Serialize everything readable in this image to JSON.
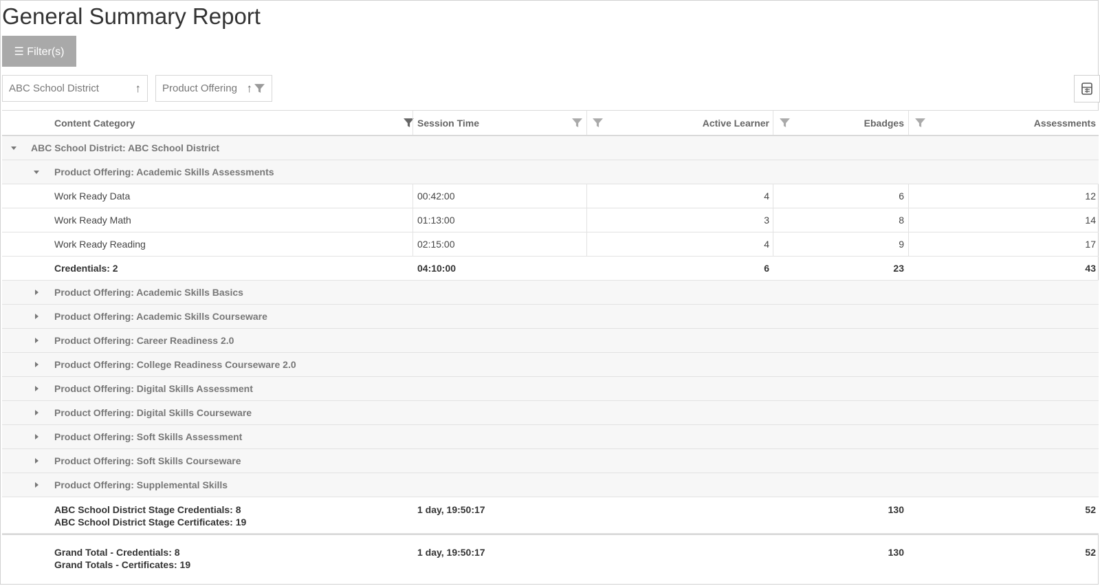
{
  "page": {
    "title": "General Summary Report"
  },
  "toolbar": {
    "filter_label": "☰ Filter(s)"
  },
  "grouping": {
    "chips": [
      {
        "label": "ABC School District"
      },
      {
        "label": "Product Offering"
      }
    ]
  },
  "grid": {
    "columns": {
      "category": "Content Category",
      "session": "Session Time",
      "active": "Active Learner",
      "ebadges": "Ebadges",
      "assessments": "Assessments"
    },
    "district_row": {
      "label": "ABC School District: ABC School District"
    },
    "expanded_offering": {
      "label": "Product Offering: Academic Skills Assessments"
    },
    "data_rows": [
      {
        "category": "Work Ready Data",
        "session": "00:42:00",
        "active": "4",
        "ebadges": "6",
        "assessments": "12"
      },
      {
        "category": "Work Ready Math",
        "session": "01:13:00",
        "active": "3",
        "ebadges": "8",
        "assessments": "14"
      },
      {
        "category": "Work Ready Reading",
        "session": "02:15:00",
        "active": "4",
        "ebadges": "9",
        "assessments": "17"
      }
    ],
    "group_summary": {
      "category": "Credentials: 2",
      "session": "04:10:00",
      "active": "6",
      "ebadges": "23",
      "assessments": "43"
    },
    "collapsed_offerings": [
      {
        "label": "Product Offering: Academic Skills Basics"
      },
      {
        "label": "Product Offering: Academic Skills Courseware"
      },
      {
        "label": "Product Offering: Career Readiness 2.0"
      },
      {
        "label": "Product Offering: College Readiness Courseware 2.0"
      },
      {
        "label": "Product Offering: Digital Skills Assessment"
      },
      {
        "label": "Product Offering: Digital Skills Courseware"
      },
      {
        "label": "Product Offering: Soft Skills Assessment"
      },
      {
        "label": "Product Offering: Soft Skills Courseware"
      },
      {
        "label": "Product Offering: Supplemental Skills"
      }
    ],
    "district_total": {
      "line1": "ABC School District Stage Credentials: 8",
      "line2": "ABC School District Stage Certificates: 19",
      "session": "1 day, 19:50:17",
      "ebadges": "130",
      "assessments": "52"
    },
    "grand_total": {
      "line1": "Grand Total - Credentials: 8",
      "line2": "Grand Totals - Certificates: 19",
      "session": "1 day, 19:50:17",
      "ebadges": "130",
      "assessments": "52"
    }
  }
}
